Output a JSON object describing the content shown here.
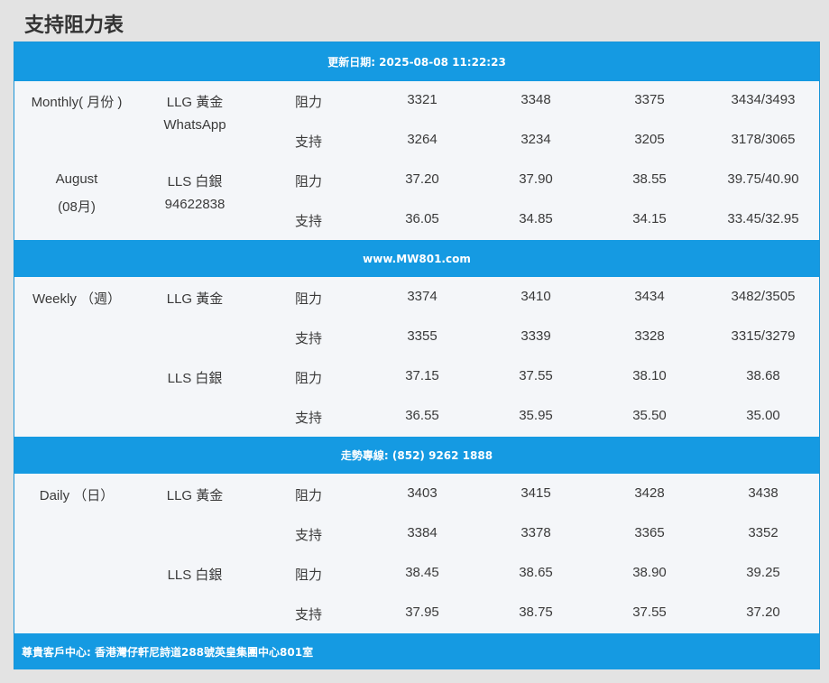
{
  "page_title": "支持阻力表",
  "banners": {
    "update": "更新日期: 2025-08-08 11:22:23",
    "website": "www.MW801.com",
    "hotline": "走勢專線: (852) 9262 1888",
    "address": "尊貴客戶中心: 香港灣仔軒尼詩道288號英皇集團中心801室"
  },
  "monthly": {
    "period_line1": "Monthly( 月份 )",
    "period_line2": "August",
    "period_line3": "(08月)",
    "gold_label": "LLG 黃金",
    "whatsapp_label": "WhatsApp",
    "silver_label": "LLS 白銀",
    "phone": "94622838",
    "rows": [
      {
        "type": "阻力",
        "values": [
          "3321",
          "3348",
          "3375",
          "3434/3493"
        ]
      },
      {
        "type": "支持",
        "values": [
          "3264",
          "3234",
          "3205",
          "3178/3065"
        ]
      },
      {
        "type": "阻力",
        "values": [
          "37.20",
          "37.90",
          "38.55",
          "39.75/40.90"
        ]
      },
      {
        "type": "支持",
        "values": [
          "36.05",
          "34.85",
          "34.15",
          "33.45/32.95"
        ]
      }
    ]
  },
  "weekly": {
    "period": "Weekly （週）",
    "gold_label": "LLG 黃金",
    "silver_label": "LLS 白銀",
    "rows": [
      {
        "type": "阻力",
        "values": [
          "3374",
          "3410",
          "3434",
          "3482/3505"
        ]
      },
      {
        "type": "支持",
        "values": [
          "3355",
          "3339",
          "3328",
          "3315/3279"
        ]
      },
      {
        "type": "阻力",
        "values": [
          "37.15",
          "37.55",
          "38.10",
          "38.68"
        ]
      },
      {
        "type": "支持",
        "values": [
          "36.55",
          "35.95",
          "35.50",
          "35.00"
        ]
      }
    ]
  },
  "daily": {
    "period": "Daily （日）",
    "gold_label": "LLG 黃金",
    "silver_label": "LLS 白銀",
    "rows": [
      {
        "type": "阻力",
        "values": [
          "3403",
          "3415",
          "3428",
          "3438"
        ]
      },
      {
        "type": "支持",
        "values": [
          "3384",
          "3378",
          "3365",
          "3352"
        ]
      },
      {
        "type": "阻力",
        "values": [
          "38.45",
          "38.65",
          "38.90",
          "39.25"
        ]
      },
      {
        "type": "支持",
        "values": [
          "37.95",
          "38.75",
          "37.55",
          "37.20"
        ]
      }
    ]
  },
  "colors": {
    "banner": "#159ae2",
    "background": "#f4f6f9",
    "page_background": "#e3e3e3"
  }
}
